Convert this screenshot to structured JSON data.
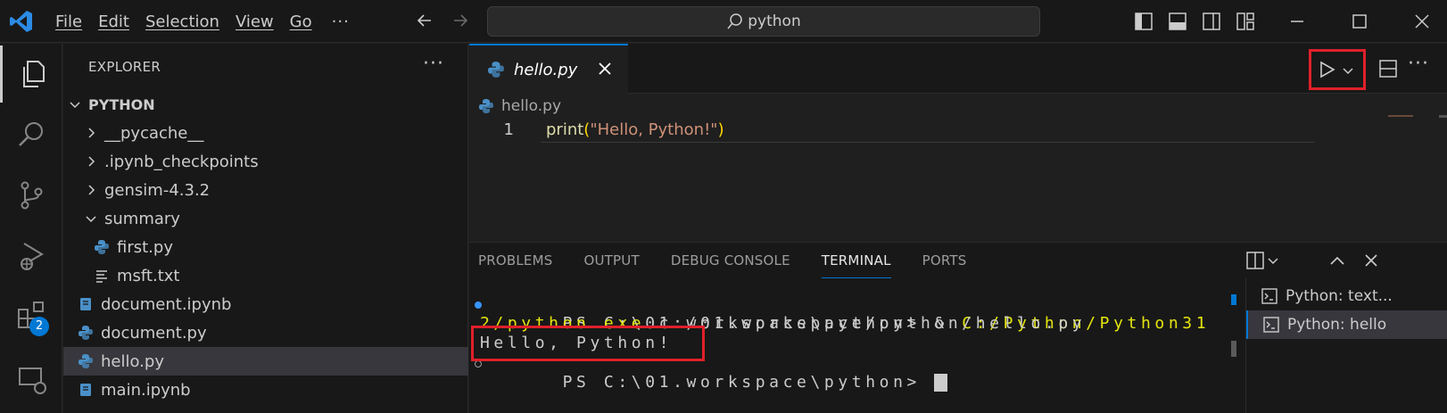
{
  "menu": [
    "File",
    "Edit",
    "Selection",
    "View",
    "Go"
  ],
  "menu_more": "···",
  "search": {
    "text": "python"
  },
  "explorer": {
    "header": "EXPLORER",
    "more": "···",
    "root": "PYTHON",
    "items": [
      {
        "label": "__pycache__",
        "type": "folder-closed"
      },
      {
        "label": ".ipynb_checkpoints",
        "type": "folder-closed"
      },
      {
        "label": "gensim-4.3.2",
        "type": "folder-closed"
      },
      {
        "label": "summary",
        "type": "folder-open"
      },
      {
        "label": "first.py",
        "type": "python-file"
      },
      {
        "label": "msft.txt",
        "type": "text-file"
      },
      {
        "label": "document.ipynb",
        "type": "notebook-file"
      },
      {
        "label": "document.py",
        "type": "python-file"
      },
      {
        "label": "hello.py",
        "type": "python-file"
      },
      {
        "label": "main.ipynb",
        "type": "notebook-file"
      }
    ]
  },
  "activity": {
    "extensions_badge": "2"
  },
  "editor": {
    "tab_label": "hello.py",
    "breadcrumb": "hello.py",
    "line_number": "1",
    "code": {
      "fn": "print",
      "open": "(",
      "str": "\"Hello, Python!\"",
      "close": ")"
    },
    "more": "···"
  },
  "panel": {
    "tabs": [
      "PROBLEMS",
      "OUTPUT",
      "DEBUG CONSOLE",
      "TERMINAL",
      "PORTS"
    ],
    "active_tab": "TERMINAL",
    "terminal": {
      "line1_prompt": "PS C:\\01.workspace\\python> & ",
      "line1_path": "C:/Python/Python31",
      "line2_path": "2/python.exe",
      "line2_rest": " c:/01.workspace/python/hello.py",
      "line3": "Hello, Python!",
      "line4": "PS C:\\01.workspace\\python> "
    },
    "terminal_list": [
      "Python: text...",
      "Python: hello"
    ]
  },
  "colors": {
    "accent": "#0078d4",
    "highlight": "#e0202a"
  }
}
